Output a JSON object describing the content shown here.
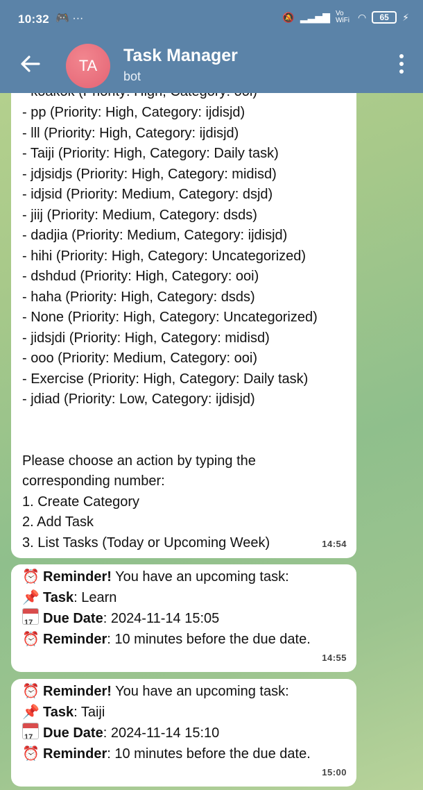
{
  "statusbar": {
    "time": "10:32",
    "left_icons": "🎮 ···",
    "signal_text": "Vo WiFi",
    "battery": "65"
  },
  "header": {
    "avatar_initials": "TA",
    "title": "Task Manager",
    "subtitle": "bot"
  },
  "messages": {
    "list_message": {
      "cut_line": "- koakok (Priority: High, Category: ooi)",
      "tasks": [
        "- pp (Priority: High, Category: ijdisjd)",
        "- lll (Priority: High, Category: ijdisjd)",
        "- Taiji (Priority: High, Category: Daily task)",
        "- jdjsidjs (Priority: High, Category: midisd)",
        "- idjsid (Priority: Medium, Category: dsjd)",
        "- jiij (Priority: Medium, Category: dsds)",
        "- dadjia (Priority: Medium, Category: ijdisjd)",
        "- hihi (Priority: High, Category: Uncategorized)",
        "- dshdud (Priority: High, Category: ooi)",
        "- haha (Priority: High, Category: dsds)",
        "- None (Priority: High, Category: Uncategorized)",
        "- jidsjdi (Priority: High, Category: midisd)",
        "- ooo (Priority: Medium, Category: ooi)",
        "- Exercise (Priority: High, Category: Daily task)",
        "- jdiad (Priority: Low, Category: ijdisjd)"
      ],
      "prompt_line1": "Please choose an action by typing the",
      "prompt_line2": "corresponding number:",
      "option1": "1. Create Category",
      "option2": "2. Add Task",
      "option3": "3. List Tasks (Today or Upcoming Week)",
      "time": "14:54"
    },
    "reminder1": {
      "head_bold": "Reminder!",
      "head_rest": " You have an upcoming task:",
      "task_label": "Task",
      "task_value": ": Learn",
      "due_label": "Due Date",
      "due_value": ": 2024-11-14 15:05",
      "rem_label": "Reminder",
      "rem_value": ": 10 minutes before the due date.",
      "time": "14:55"
    },
    "reminder2": {
      "head_bold": "Reminder!",
      "head_rest": " You have an upcoming task:",
      "task_label": "Task",
      "task_value": ": Taiji",
      "due_label": "Due Date",
      "due_value": ": 2024-11-14 15:10",
      "rem_label": "Reminder",
      "rem_value": ": 10 minutes before the due date.",
      "time": "15:00"
    }
  },
  "icons": {
    "alarm": "⏰",
    "pin": "📌",
    "calendar_day": "17"
  },
  "colors": {
    "header": "#5b83a8",
    "avatar": "#e46474",
    "bubble": "#ffffff"
  }
}
